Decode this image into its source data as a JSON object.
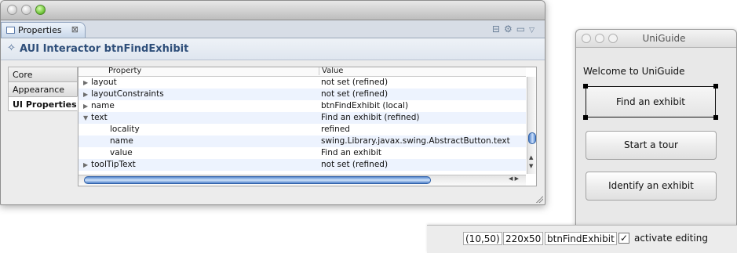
{
  "properties_window": {
    "tab_label": "Properties",
    "tab_close": "⊠",
    "header_title": "AUI Interactor btnFindExhibit",
    "categories": [
      {
        "label": "Core"
      },
      {
        "label": "Appearance"
      },
      {
        "label": "UI Properties"
      }
    ],
    "selected_category": "UI Properties",
    "columns": {
      "property": "Property",
      "value": "Value"
    },
    "rows": [
      {
        "property": "layout",
        "value": "not set (refined)",
        "expander": "▶"
      },
      {
        "property": "layoutConstraints",
        "value": "not set (refined)",
        "expander": "▶"
      },
      {
        "property": "name",
        "value": "btnFindExhibit (local)",
        "expander": "▶"
      },
      {
        "property": "text",
        "value": "Find an exhibit (refined)",
        "expander": "▼"
      },
      {
        "property": "locality",
        "value": "refined",
        "expander": ""
      },
      {
        "property": "name",
        "value": "swing.Library.javax.swing.AbstractButton.text",
        "expander": ""
      },
      {
        "property": "value",
        "value": "Find an exhibit",
        "expander": ""
      },
      {
        "property": "toolTipText",
        "value": "not set (refined)",
        "expander": "▶"
      }
    ]
  },
  "uniguide_window": {
    "title": "UniGuide",
    "welcome": "Welcome to UniGuide",
    "buttons": [
      {
        "label": "Find an exhibit"
      },
      {
        "label": "Start a tour"
      },
      {
        "label": "Identify an exhibit"
      }
    ]
  },
  "status_bar": {
    "position": "(10,50)",
    "size": "220x50",
    "component": "btnFindExhibit",
    "activate_editing_label": "activate editing",
    "activate_editing_checked": true
  },
  "icons": {
    "tab": "properties-view-icon",
    "header": "aui-interactor-icon",
    "checkbox_mark": "✓"
  }
}
